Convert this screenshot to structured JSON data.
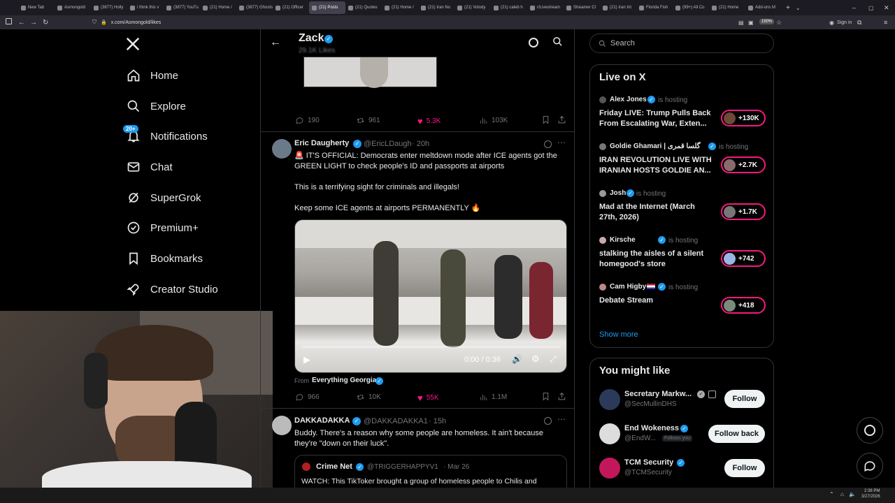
{
  "browser": {
    "tabs": [
      {
        "label": "New Tab"
      },
      {
        "label": "Asmongold"
      },
      {
        "label": "(3877) Holly"
      },
      {
        "label": "i think this v"
      },
      {
        "label": "(3877) YouTu"
      },
      {
        "label": "(21) Home /"
      },
      {
        "label": "(3877) Ghosts"
      },
      {
        "label": "(21) Officer"
      },
      {
        "label": "(21) Posts"
      },
      {
        "label": "(21) Quotes"
      },
      {
        "label": "(21) Home /"
      },
      {
        "label": "(21) Iran No"
      },
      {
        "label": "(21) Volody"
      },
      {
        "label": "(21) caleb h"
      },
      {
        "label": "r/Livestream"
      },
      {
        "label": "Streamer Cl"
      },
      {
        "label": "(21) Iran Int"
      },
      {
        "label": "Florida Fish"
      },
      {
        "label": "(99+) All Co"
      },
      {
        "label": "(21) Home"
      },
      {
        "label": "Add-ons M"
      }
    ],
    "url": "x.com/Asmongold/likes",
    "zoom": "150%",
    "signin": "Sign in"
  },
  "sidebar": {
    "items": [
      {
        "label": "Home",
        "icon": "home-icon"
      },
      {
        "label": "Explore",
        "icon": "search-icon"
      },
      {
        "label": "Notifications",
        "icon": "bell-icon",
        "badge": "20+"
      },
      {
        "label": "Chat",
        "icon": "mail-icon"
      },
      {
        "label": "SuperGrok",
        "icon": "grok-icon"
      },
      {
        "label": "Premium+",
        "icon": "premium-icon"
      },
      {
        "label": "Bookmarks",
        "icon": "bookmark-icon"
      },
      {
        "label": "Creator Studio",
        "icon": "rocket-icon"
      }
    ]
  },
  "header": {
    "name": "Zack",
    "sub": "29.1K Likes"
  },
  "posts": [
    {
      "stats": {
        "replies": "190",
        "reposts": "961",
        "likes": "5.3K",
        "views": "103K"
      }
    },
    {
      "author": "Eric Daugherty",
      "handle": "@EricLDaugh",
      "time": "· 20h",
      "line1": "🚨 IT'S OFFICIAL: Democrats enter meltdown mode after ICE agents got the GREEN LIGHT to check people's ID and passports at airports",
      "line2": "This is a terrifying sight for criminals and illegals!",
      "line3": "Keep some ICE agents at airports PERMANENTLY 🔥",
      "video_time": "0:00 / 0:36",
      "from_label": "From",
      "from_source": "Everything Georgia",
      "stats": {
        "replies": "966",
        "reposts": "10K",
        "likes": "55K",
        "views": "1.1M"
      }
    },
    {
      "author": "DAKKADAKKA",
      "handle": "@DAKKADAKKA1",
      "time": "· 15h",
      "text": "Buddy. There's a reason why some people are homeless. It ain't because they're \"down on their luck\".",
      "quote": {
        "author": "Crime Net",
        "handle": "@TRIGGERHAPPYV1",
        "time": "· Mar 26",
        "text": "WATCH: This TikToker brought a group of homeless people to Chilis and"
      }
    }
  ],
  "search": {
    "placeholder": "Search"
  },
  "live": {
    "title": "Live on X",
    "hosting": "is hosting",
    "items": [
      {
        "name": "Alex Jones",
        "title1": "Friday LIVE: Trump Pulls Back",
        "title2": "From Escalating War, Exten...",
        "count": "+130K"
      },
      {
        "name": "Goldie Ghamari | گلسا قمری",
        "title1": "IRAN REVOLUTION LIVE WITH",
        "title2": "IRANIAN HOSTS GOLDIE AN...",
        "count": "+2.7K"
      },
      {
        "name": "Josh",
        "title1": "Mad at the Internet (March",
        "title2": "27th, 2026)",
        "count": "+1.7K"
      },
      {
        "name": "Kirsche",
        "title1": "stalking the aisles of a silent",
        "title2": "homegood's store",
        "count": "+742"
      },
      {
        "name": "Cam Higby",
        "title1": "Debate Stream",
        "title2": "",
        "count": "+418"
      }
    ],
    "show_more": "Show more"
  },
  "suggest": {
    "title": "You might like",
    "items": [
      {
        "name": "Secretary Markw...",
        "handle": "@SecMullinDHS",
        "extra": "",
        "button": "Follow"
      },
      {
        "name": "End Wokeness",
        "handle": "@EndW...",
        "extra": "Follows you",
        "button": "Follow back"
      },
      {
        "name": "TCM Security",
        "handle": "@TCMSecurity",
        "extra": "",
        "button": "Follow"
      }
    ]
  },
  "clock": {
    "time": "2:38 PM",
    "date": "3/27/2026"
  },
  "colors": {
    "accent": "#1d9bf0",
    "like": "#f91880"
  }
}
